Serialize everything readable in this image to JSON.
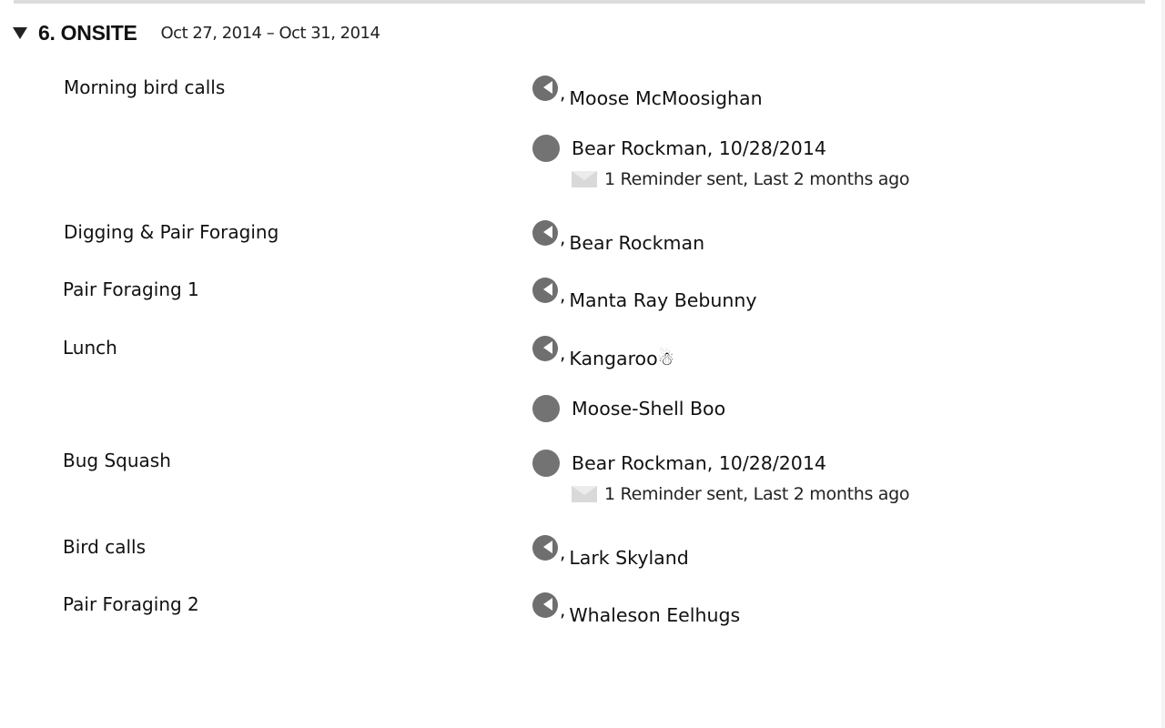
{
  "section": {
    "title": "6. ONSITE",
    "dates": "Oct 27, 2014 – Oct 31, 2014"
  },
  "rows": [
    {
      "task": "Morning bird calls",
      "assignee": "Moose McMoosighan",
      "type": "flag"
    },
    {
      "task": "",
      "assignee": "Bear Rockman, 10/28/2014",
      "type": "dot",
      "reminder": "1 Reminder sent, Last 2 months ago"
    },
    {
      "task": "Digging & Pair Foraging",
      "assignee": "Bear Rockman",
      "type": "flag"
    },
    {
      "task": "Pair Foraging 1",
      "assignee": "Manta Ray Bebunny",
      "type": "flag"
    },
    {
      "task": "Lunch",
      "assignee": "Kangaroo☃",
      "type": "flag"
    },
    {
      "task": "",
      "assignee": "Moose-Shell Boo",
      "type": "dot"
    },
    {
      "task": "Bug Squash",
      "assignee": "Bear Rockman, 10/28/2014",
      "type": "dot",
      "reminder": "1 Reminder sent, Last 2 months ago"
    },
    {
      "task": "Bird calls",
      "assignee": "Lark Skyland",
      "type": "flag"
    },
    {
      "task": "Pair Foraging 2",
      "assignee": "Whaleson Eelhugs",
      "type": "flag"
    }
  ],
  "icons": {
    "toggle": "triangle-down-icon",
    "flag_avatar": "flag-avatar-icon",
    "dot_avatar": "avatar-dot-icon",
    "mail": "mail-icon"
  }
}
